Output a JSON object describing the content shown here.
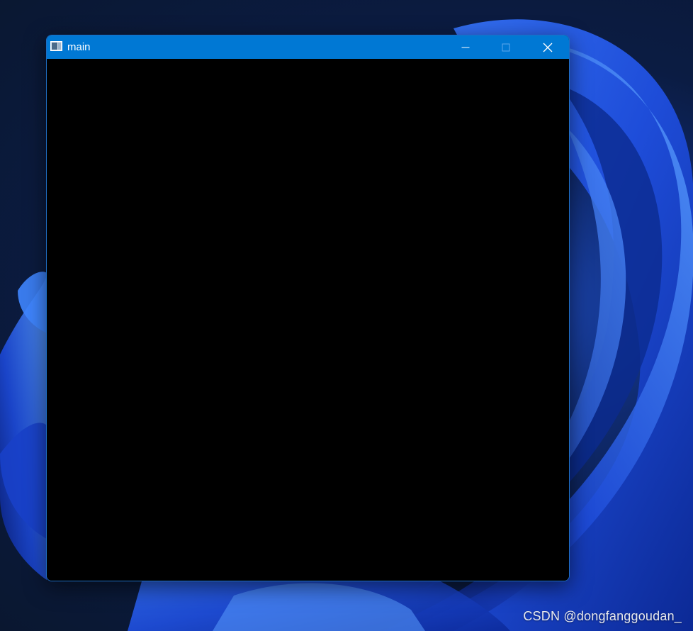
{
  "window": {
    "title": "main",
    "icon": "window-app-icon",
    "titlebar_color": "#0078d4",
    "client_color": "#000000",
    "controls": {
      "minimize_icon": "minimize-icon",
      "maximize_icon": "maximize-icon",
      "close_icon": "close-icon"
    }
  },
  "desktop": {
    "wallpaper": "blue-bloom-wallpaper",
    "watermark": "CSDN @dongfanggoudan_"
  }
}
